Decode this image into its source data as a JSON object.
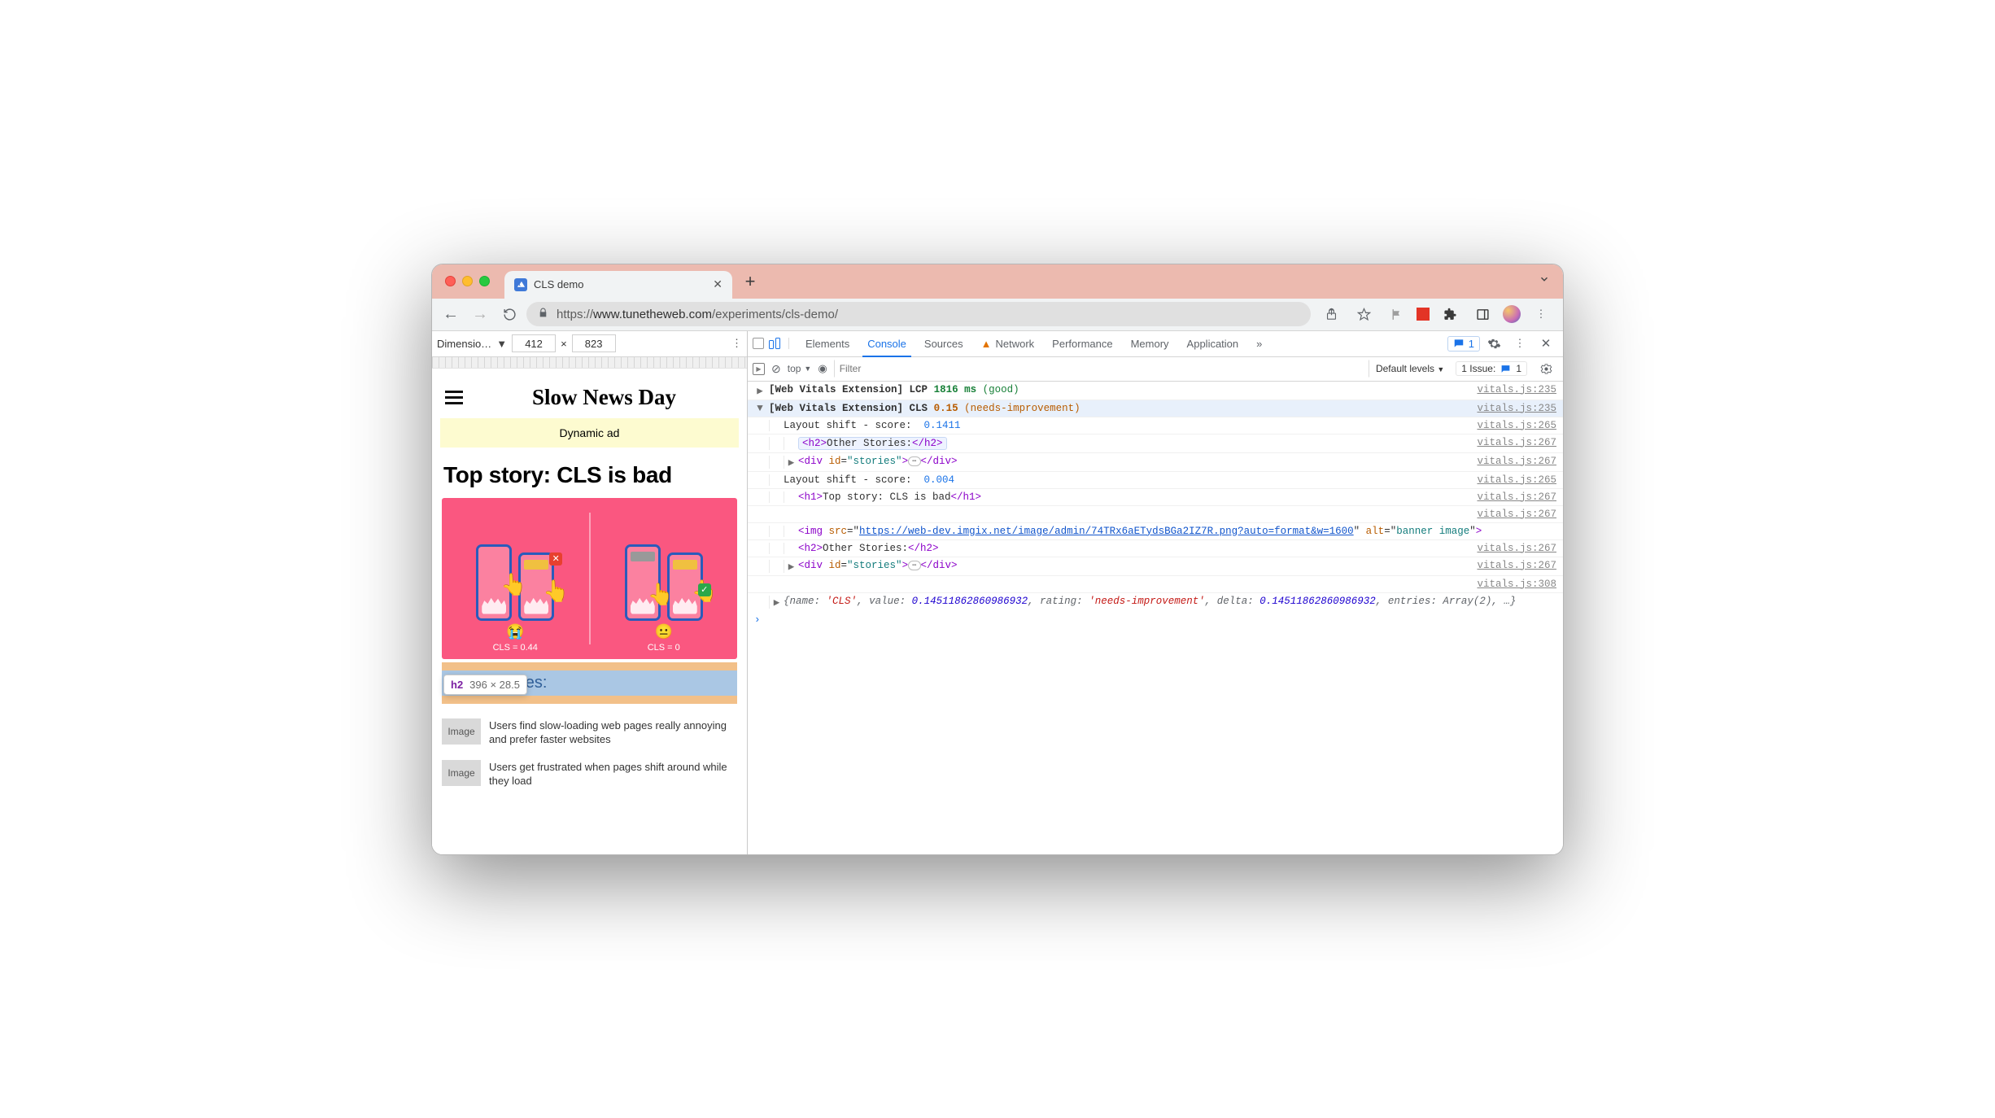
{
  "tab": {
    "title": "CLS demo"
  },
  "urlbar": {
    "scheme": "https://",
    "host": "www.tunetheweb.com",
    "path": "/experiments/cls-demo/"
  },
  "device_toolbar": {
    "label": "Dimensio…",
    "width": "412",
    "x": "×",
    "height": "823"
  },
  "page": {
    "masthead": "Slow News Day",
    "ad": "Dynamic ad",
    "top_story": "Top story: CLS is bad",
    "banner_left_caption": "CLS = 0.44",
    "banner_right_caption": "CLS = 0",
    "tooltip_tag": "h2",
    "tooltip_size": "396 × 28.5",
    "other_stories": "Other Stories:",
    "thumb_label": "Image",
    "stories": [
      "Users find slow-loading web pages really annoying and prefer faster websites",
      "Users get frustrated when pages shift around while they load"
    ]
  },
  "devtools": {
    "tabs": [
      "Elements",
      "Console",
      "Sources",
      "Network",
      "Performance",
      "Memory",
      "Application"
    ],
    "more": "»",
    "chip_count": "1",
    "consolebar": {
      "scope": "top",
      "filter_placeholder": "Filter",
      "levels": "Default levels",
      "issues_label": "1 Issue:",
      "issues_count": "1"
    },
    "log": [
      {
        "type": "lcp",
        "prefix": "[Web Vitals Extension] LCP",
        "value": "1816 ms",
        "rating": "(good)",
        "src": "vitals.js:235"
      },
      {
        "type": "cls-head",
        "prefix": "[Web Vitals Extension] CLS",
        "value": "0.15",
        "rating": "(needs-improvement)",
        "src": "vitals.js:235"
      },
      {
        "type": "shift",
        "label": "Layout shift - score:",
        "value": "0.1411",
        "src": "vitals.js:265"
      },
      {
        "type": "h2chip",
        "text": "Other Stories:",
        "src": "vitals.js:267"
      },
      {
        "type": "div-stories",
        "src": "vitals.js:267"
      },
      {
        "type": "shift",
        "label": "Layout shift - score:",
        "value": "0.004",
        "src": "vitals.js:265"
      },
      {
        "type": "h1",
        "text": "Top story: CLS is bad",
        "src": "vitals.js:267"
      },
      {
        "type": "src-only",
        "src": "vitals.js:267"
      },
      {
        "type": "img",
        "url": "https://web-dev.imgix.net/image/admin/74TRx6aETydsBGa2IZ7R.png?auto=format&w=1600",
        "alt": "banner image"
      },
      {
        "type": "h2plain",
        "text": "Other Stories:",
        "src": "vitals.js:267"
      },
      {
        "type": "div-stories",
        "src": "vitals.js:267"
      },
      {
        "type": "src-only",
        "src": "vitals.js:308"
      },
      {
        "type": "object",
        "text": "{name: 'CLS', value: 0.14511862860986932, rating: 'needs-improvement', delta: 0.14511862860986932, entries: Array(2), …}"
      }
    ]
  }
}
